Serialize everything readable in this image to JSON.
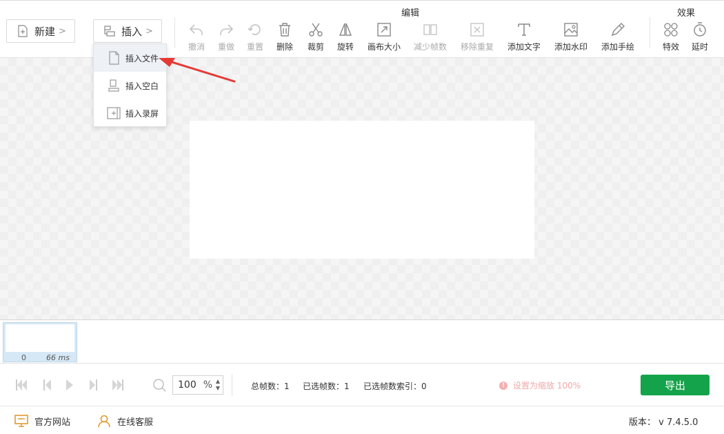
{
  "toolbar": {
    "new_label": "新建",
    "insert_label": "插入",
    "edit_group_title": "编辑",
    "effects_group_title": "效果",
    "tools": [
      {
        "label": "撤消",
        "icon": "undo-icon",
        "enabled": false
      },
      {
        "label": "重做",
        "icon": "redo-icon",
        "enabled": false
      },
      {
        "label": "重置",
        "icon": "reset-icon",
        "enabled": false
      },
      {
        "label": "删除",
        "icon": "trash-icon",
        "enabled": true
      },
      {
        "label": "裁剪",
        "icon": "scissors-icon",
        "enabled": true
      },
      {
        "label": "旋转",
        "icon": "rotate-icon",
        "enabled": true
      },
      {
        "label": "画布大小",
        "icon": "canvas-size-icon",
        "enabled": true
      },
      {
        "label": "减少帧数",
        "icon": "reduce-frames-icon",
        "enabled": false
      },
      {
        "label": "移除重复",
        "icon": "remove-duplicates-icon",
        "enabled": false
      },
      {
        "label": "添加文字",
        "icon": "text-icon",
        "enabled": true
      },
      {
        "label": "添加水印",
        "icon": "watermark-icon",
        "enabled": true
      },
      {
        "label": "添加手绘",
        "icon": "pencil-icon",
        "enabled": true
      },
      {
        "label": "特效",
        "icon": "effects-icon",
        "enabled": true
      },
      {
        "label": "延时",
        "icon": "timer-icon",
        "enabled": true
      }
    ]
  },
  "insert_menu": {
    "items": [
      {
        "label": "插入文件",
        "icon": "insert-file-icon",
        "highlighted": true
      },
      {
        "label": "插入空白",
        "icon": "insert-blank-icon",
        "highlighted": false
      },
      {
        "label": "插入录屏",
        "icon": "insert-recording-icon",
        "highlighted": false
      }
    ]
  },
  "frames": [
    {
      "index": "0",
      "duration": "66 ms"
    }
  ],
  "playback": {
    "zoom_value": "100",
    "zoom_unit": "%",
    "total_frames": "总帧数：1",
    "selected_frames": "已选帧数：1",
    "selected_index": "已选帧数索引：0",
    "hint": "设置为缩放 100%",
    "export_label": "导出"
  },
  "footer": {
    "website_label": "官方网站",
    "support_label": "在线客服",
    "version": "版本：  v 7.4.5.0"
  },
  "colors": {
    "accent_green": "#14a34a",
    "arrow_red": "#e53935",
    "hint_pink": "#f0a8a8"
  }
}
